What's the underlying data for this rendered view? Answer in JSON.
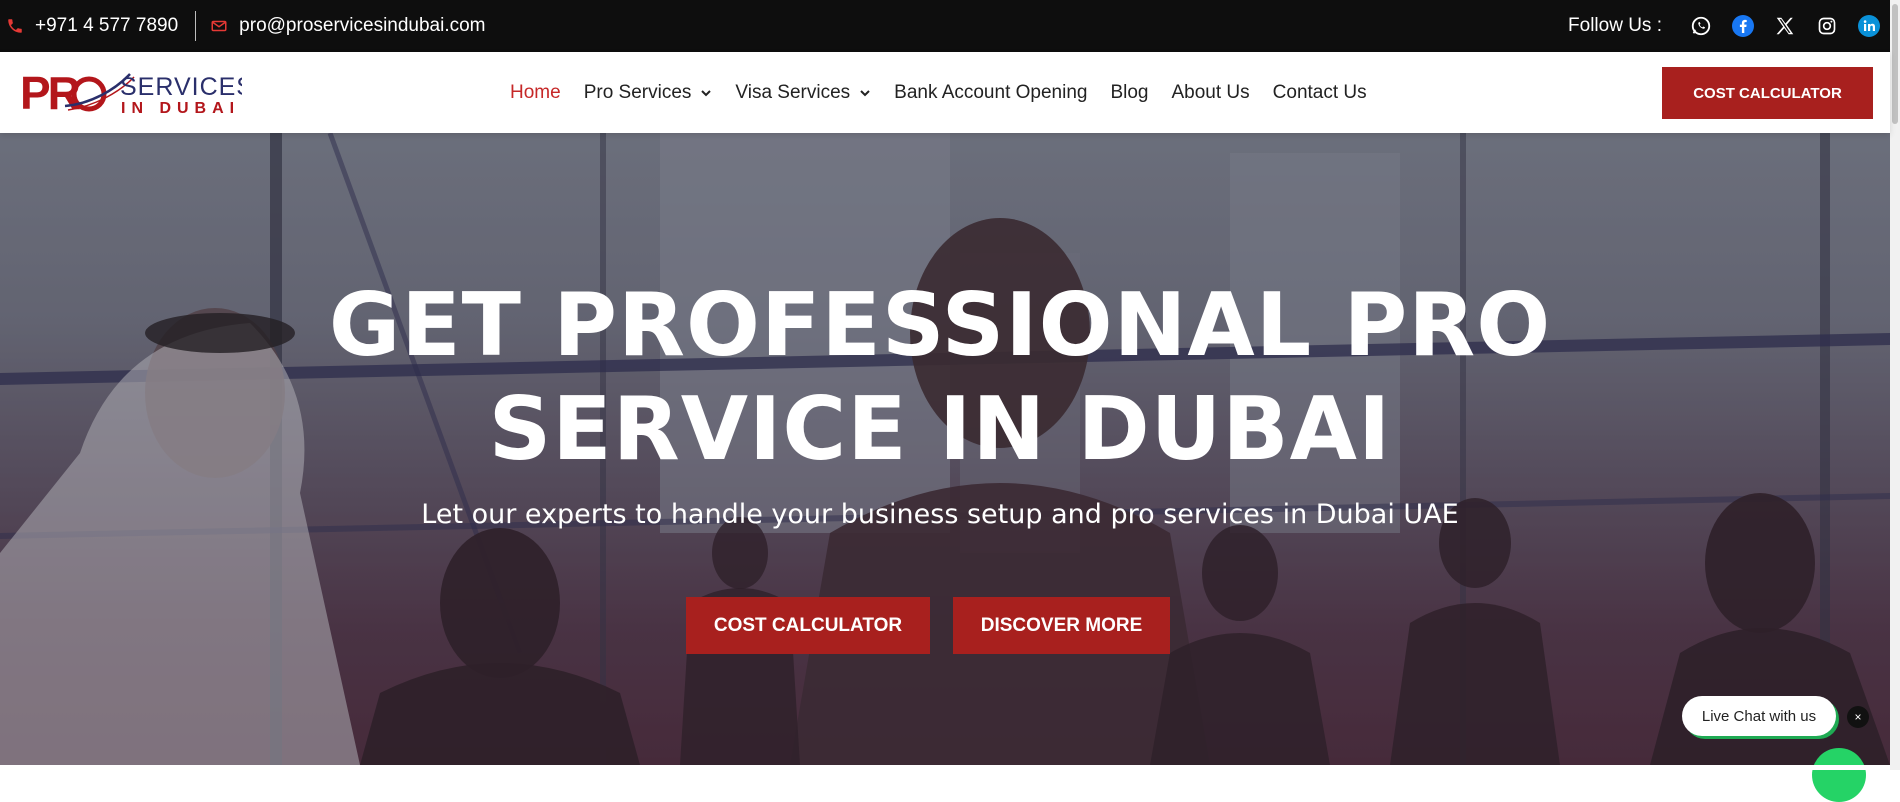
{
  "topbar": {
    "phone": "+971 4 577 7890",
    "email": "pro@proservicesindubai.com",
    "follow_label": "Follow Us :",
    "socials": [
      "whatsapp-icon",
      "facebook-icon",
      "x-twitter-icon",
      "instagram-icon",
      "linkedin-icon"
    ]
  },
  "logo": {
    "mark": "PRO",
    "line1": "SERVICES",
    "line2": "IN DUBAI"
  },
  "nav": {
    "items": [
      {
        "label": "Home",
        "active": true
      },
      {
        "label": "Pro Services",
        "dropdown": true
      },
      {
        "label": "Visa Services",
        "dropdown": true
      },
      {
        "label": "Bank Account Opening"
      },
      {
        "label": "Blog"
      },
      {
        "label": "About Us"
      },
      {
        "label": "Contact Us"
      }
    ],
    "cta_label": "COST CALCULATOR"
  },
  "hero": {
    "title_line1": "GET PROFESSIONAL PRO",
    "title_line2": "SERVICE IN DUBAI",
    "subtitle": "Let our experts to handle your business setup and pro services in Dubai UAE",
    "btn_cost": "COST CALCULATOR",
    "btn_discover": "DISCOVER MORE"
  },
  "chat": {
    "label": "Live Chat with us",
    "close": "×"
  },
  "colors": {
    "brand_red": "#a8201e",
    "active_nav": "#c62828",
    "topbar_bg": "#0e0e0e",
    "whatsapp_green": "#25d366"
  }
}
